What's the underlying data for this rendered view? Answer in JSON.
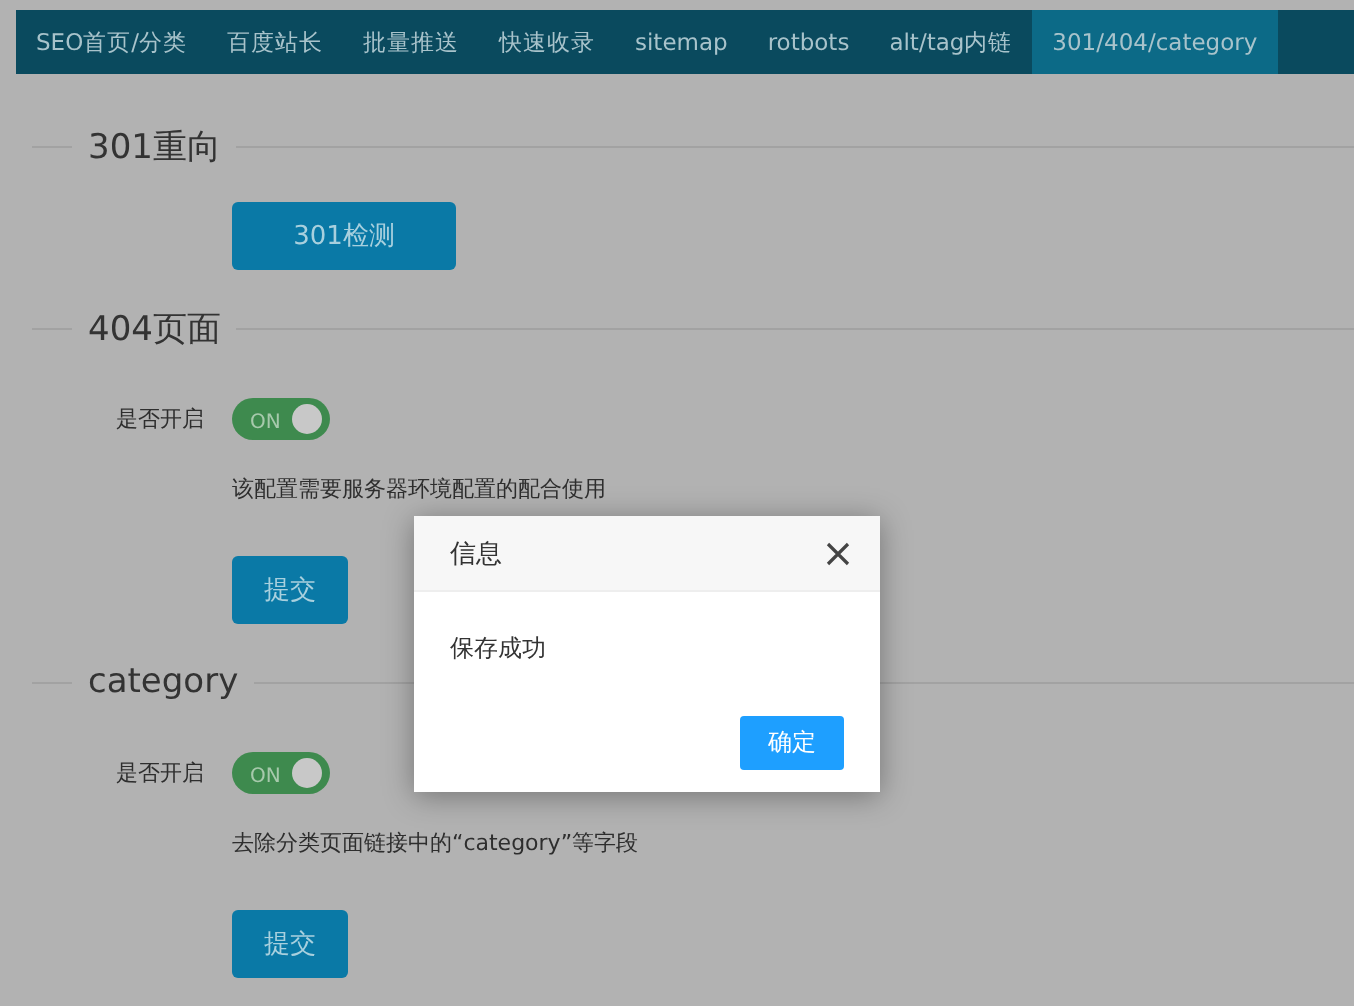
{
  "tabs": [
    {
      "label": "SEO首页/分类",
      "selected": false
    },
    {
      "label": "百度站长",
      "selected": false
    },
    {
      "label": "批量推送",
      "selected": false
    },
    {
      "label": "快速收录",
      "selected": false
    },
    {
      "label": "sitemap",
      "selected": false
    },
    {
      "label": "rotbots",
      "selected": false
    },
    {
      "label": "alt/tag内链",
      "selected": false
    },
    {
      "label": "301/404/category",
      "selected": true
    }
  ],
  "sections": [
    {
      "title": "301重向",
      "kind": "action",
      "button": "301检测"
    },
    {
      "title": "404页面",
      "kind": "toggle",
      "label": "是否开启",
      "switch_text": "ON",
      "on": true,
      "note": "该配置需要服务器环境配置的配合使用",
      "button": "提交"
    },
    {
      "title": "category",
      "kind": "toggle",
      "label": "是否开启",
      "switch_text": "ON",
      "on": true,
      "note": "去除分类页面链接中的“category”等字段",
      "button": "提交"
    }
  ],
  "dialog": {
    "title": "信息",
    "message": "保存成功",
    "button": "确定"
  }
}
